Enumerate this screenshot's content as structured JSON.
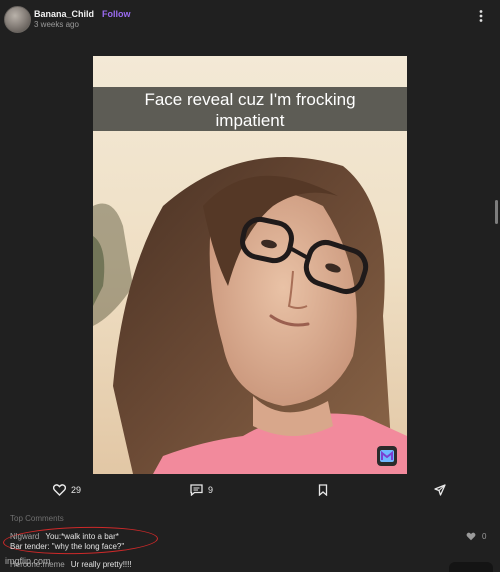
{
  "post": {
    "username": "Banana_Child",
    "follow_label": "Follow",
    "timestamp": "3 weeks ago",
    "caption_line1": "Face reveal cuz I'm frocking",
    "caption_line2": "impatient"
  },
  "actions": {
    "likes": "29",
    "comments": "9"
  },
  "comments_section": {
    "label": "Top Comments",
    "comment1": {
      "author": "Nlgward",
      "line1": "You:*walk into a bar*",
      "line2": "Bar tender: \"why the long face?\"",
      "likes": "0"
    },
    "comment2": {
      "author": "Hercone.meme",
      "text": "Ur really pretty!!!!"
    }
  },
  "watermark": "imgflip.com",
  "colors": {
    "background": "#202020",
    "follow": "#9b6bf2",
    "annotation_circle": "#cc2929"
  }
}
